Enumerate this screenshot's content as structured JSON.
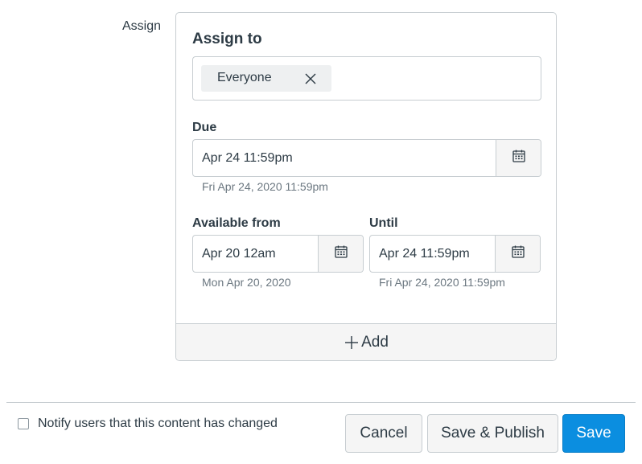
{
  "assign_label": "Assign",
  "assign_card": {
    "assign_to_title": "Assign to",
    "assignees": [
      {
        "label": "Everyone",
        "remove_icon": "close-icon"
      }
    ],
    "due": {
      "label": "Due",
      "value": "Apr 24 11:59pm",
      "helper": "Fri Apr 24, 2020 11:59pm",
      "icon": "calendar-icon"
    },
    "available_from": {
      "label": "Available from",
      "value": "Apr 20 12am",
      "helper": "Mon Apr 20, 2020",
      "icon": "calendar-icon"
    },
    "until": {
      "label": "Until",
      "value": "Apr 24 11:59pm",
      "helper": "Fri Apr 24, 2020 11:59pm",
      "icon": "calendar-icon"
    },
    "add_label": "Add",
    "add_icon": "plus-icon"
  },
  "footer": {
    "notify_label": "Notify users that this content has changed",
    "notify_checked": false,
    "cancel_label": "Cancel",
    "save_publish_label": "Save & Publish",
    "save_label": "Save"
  },
  "colors": {
    "primary": "#0b8ee0",
    "border": "#c7cdd1",
    "text": "#2d3b45",
    "muted": "#6b7780"
  }
}
